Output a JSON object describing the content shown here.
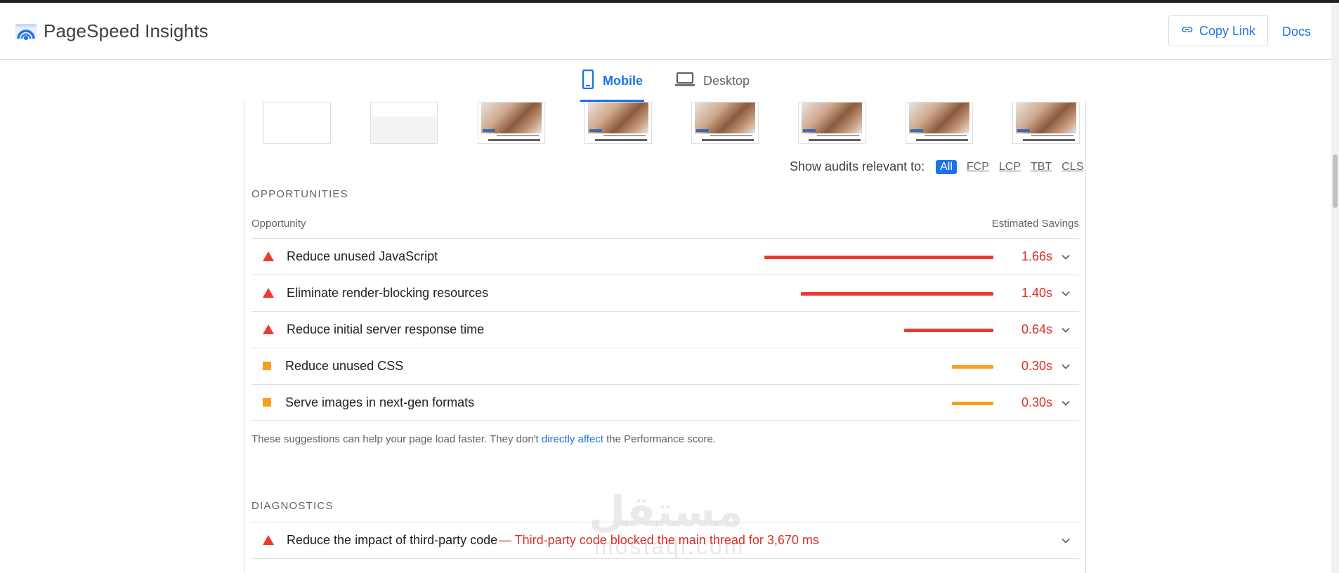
{
  "header": {
    "brand": "PageSpeed Insights",
    "copy_link": "Copy Link",
    "docs": "Docs"
  },
  "tabs": [
    {
      "label": "Mobile",
      "active": true
    },
    {
      "label": "Desktop",
      "active": false
    }
  ],
  "filmstrip": [
    {
      "kind": "blank",
      "caption": ""
    },
    {
      "kind": "gray",
      "caption": ""
    },
    {
      "kind": "image",
      "caption": "لا تجلوات ازالة شعر الرجال بالفلفل"
    },
    {
      "kind": "image",
      "caption": "لا تجلوات ازالة شعر الرجال بالفلفل"
    },
    {
      "kind": "image",
      "caption": "لا تجلوات ازالة شعر الرجال بالفلفل"
    },
    {
      "kind": "image",
      "caption": "لا تجلوات ازالة شعر الرجال بالفلفل"
    },
    {
      "kind": "image",
      "caption": "لا تجلوات ازالة شعر الرجال بالفلفل"
    },
    {
      "kind": "image",
      "caption": "لا تجلوات ازالة شعر الرجال بالفلفل"
    }
  ],
  "relevance": {
    "label": "Show audits relevant to:",
    "chips": [
      {
        "label": "All",
        "active": true
      },
      {
        "label": "FCP",
        "active": false
      },
      {
        "label": "LCP",
        "active": false
      },
      {
        "label": "TBT",
        "active": false
      },
      {
        "label": "CLS",
        "active": false
      }
    ]
  },
  "opportunities": {
    "title": "OPPORTUNITIES",
    "col_left": "Opportunity",
    "col_right": "Estimated Savings",
    "items": [
      {
        "title": "Reduce unused JavaScript",
        "savings": "1.66s",
        "severity": "fail",
        "fraction": 1.0
      },
      {
        "title": "Eliminate render-blocking resources",
        "savings": "1.40s",
        "severity": "fail",
        "fraction": 0.84
      },
      {
        "title": "Reduce initial server response time",
        "savings": "0.64s",
        "severity": "fail",
        "fraction": 0.39
      },
      {
        "title": "Reduce unused CSS",
        "savings": "0.30s",
        "severity": "average",
        "fraction": 0.18
      },
      {
        "title": "Serve images in next-gen formats",
        "savings": "0.30s",
        "severity": "average",
        "fraction": 0.18
      }
    ],
    "note_before": "These suggestions can help your page load faster. They don't ",
    "note_link": "directly affect",
    "note_after": " the Performance score."
  },
  "diagnostics": {
    "title": "DIAGNOSTICS",
    "items": [
      {
        "title": "Reduce the impact of third-party code",
        "detail": "— Third-party code blocked the main thread for 3,670 ms",
        "severity": "fail"
      }
    ]
  },
  "watermark": {
    "arabic": "مستقل",
    "latin": "mostaql.com"
  },
  "colors": {
    "accent": "#1a73e8",
    "fail": "#eb3b2f",
    "average": "#fb9e1b",
    "fail_text": "#d93025"
  }
}
